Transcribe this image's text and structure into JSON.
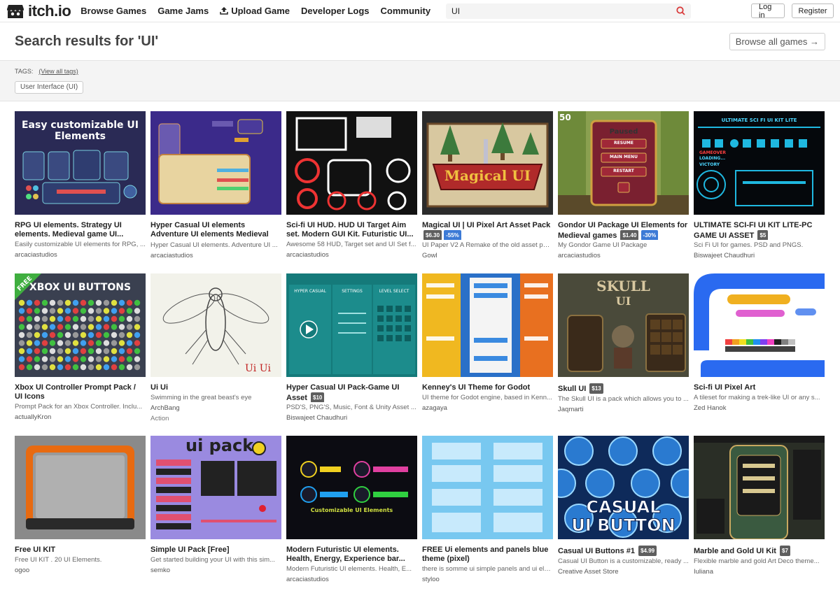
{
  "header": {
    "logo_text": "itch.io",
    "nav": [
      "Browse Games",
      "Game Jams",
      "Upload Game",
      "Developer Logs",
      "Community"
    ],
    "search_value": "UI",
    "login": "Log in",
    "register": "Register"
  },
  "page": {
    "title": "Search results for 'UI'",
    "browse_all": "Browse all games →"
  },
  "tags": {
    "label": "TAGS:",
    "view_all": "(View all tags)",
    "pill": "User Interface (UI)"
  },
  "thumb_text": {
    "rpg": "Easy customizable UI Elements",
    "xbox": "XBOX UI BUTTONS",
    "free_ribbon": "FREE",
    "magical": "Magical UI",
    "paused": "Paused",
    "resume": "RESUME",
    "main_menu": "MAIN MENU",
    "restart": "RESTART",
    "scifi_lite": "ULTIMATE SCI FI UI KIT LITE",
    "gameover": "GAMEOVER",
    "loading": "LOADING...",
    "victory": "VICTORY",
    "fifty": "50",
    "uiui": "Ui Ui",
    "hc_tab1": "HYPER CASUAL",
    "hc_tab2": "SETTINGS",
    "hc_tab3": "LEVEL SELECT",
    "skull": "SKULL",
    "skull_ui": "UI",
    "uipack": "ui pack",
    "customizable": "Customizable UI Elements",
    "casual1": "CASUAL",
    "casual2": "UI BUTTON"
  },
  "games": [
    {
      "title": "RPG UI elements. Strategy UI elements. Medieval game UI...",
      "desc": "Easily customizable UI elements for RPG, ...",
      "author": "arcaciastudios"
    },
    {
      "title": "Hyper Casual UI elements Adventure UI elements Medieval game UI...",
      "desc": "Hyper Casual UI elements. Adventure UI ...",
      "author": "arcaciastudios"
    },
    {
      "title": "Sci-fi UI HUD. HUD UI Target Aim set. Modern GUI Kit. Futuristic UI...",
      "desc": "Awesome 58 HUD, Target set and UI Set f...",
      "author": "arcaciastudios"
    },
    {
      "title": "Magical UI | UI Pixel Art Asset Pack",
      "price": "$6.30",
      "sale": "-55%",
      "desc": "UI Paper V2 A Remake of the old asset pack",
      "author": "Gowl"
    },
    {
      "title": "Gondor UI Package UI Elements for Medieval games",
      "price": "$1.40",
      "sale": "-30%",
      "desc": "My Gondor Game UI Package",
      "author": "arcaciastudios"
    },
    {
      "title": "ULTIMATE SCI-FI UI KIT LITE-PC GAME UI ASSET",
      "price": "$5",
      "desc": "Sci Fi UI for games. PSD and PNGS.",
      "author": "Biswajeet Chaudhuri"
    },
    {
      "title": "Xbox UI Controller Prompt Pack / UI Icons",
      "desc": "Prompt Pack for an Xbox Controller. Inclu...",
      "author": "actuallyKron"
    },
    {
      "title": "Ui Ui",
      "desc": "Swimming in the great beast's eye",
      "author": "ArchBang",
      "genre": "Action"
    },
    {
      "title": "Hyper Casual UI Pack-Game UI Asset",
      "price": "$10",
      "desc": "PSD'S, PNG'S, Music, Font & Unity Asset ...",
      "author": "Biswajeet Chaudhuri"
    },
    {
      "title": "Kenney's UI Theme for Godot",
      "desc": "UI theme for Godot engine, based in Kenn...",
      "author": "azagaya"
    },
    {
      "title": "Skull UI",
      "price": "$13",
      "desc": "The Skull UI is a pack which allows you to ...",
      "author": "Jaqmarti"
    },
    {
      "title": "Sci-fi UI Pixel Art",
      "desc": "A tileset for making a trek-like UI or any s...",
      "author": "Zed Hanok"
    },
    {
      "title": "Free UI KIT",
      "desc": "Free UI KIT . 20 UI Elements.",
      "author": "ogoo"
    },
    {
      "title": "Simple UI Pack [Free]",
      "desc": "Get started building your UI with this sim...",
      "author": "semko"
    },
    {
      "title": "Modern Futuristic UI elements. Health, Energy, Experience bar...",
      "desc": "Modern Futuristic UI elements. Health, E...",
      "author": "arcaciastudios"
    },
    {
      "title": "FREE Ui elements and panels blue theme (pixel)",
      "desc": "there is somme ui simple panels and ui ele...",
      "author": "styloo"
    },
    {
      "title": "Casual UI Buttons #1",
      "price": "$4.99",
      "desc": "Casual UI Button is a customizable, ready ...",
      "author": "Creative Asset Store"
    },
    {
      "title": "Marble and Gold UI Kit",
      "price": "$7",
      "desc": "Flexible marble and gold Art Deco theme...",
      "author": "Iuliana"
    }
  ]
}
